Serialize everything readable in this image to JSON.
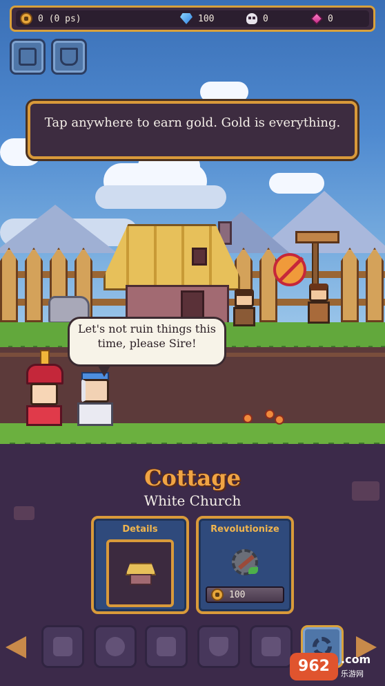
{
  "hud": {
    "gold": "0 (0 ps)",
    "gems": "100",
    "skulls": "0",
    "rubies": "0"
  },
  "icons": {
    "gold": "coin-icon",
    "gems": "diamond-icon",
    "skulls": "skull-icon",
    "rubies": "pink-gem-icon",
    "top_left_1": "map-icon",
    "top_left_2": "trophy-book-icon"
  },
  "tutorial": {
    "text": "Tap anywhere to earn gold. Gold is everything."
  },
  "speech": {
    "text": "Let's not ruin things this time, please Sire!"
  },
  "building": {
    "name": "Cottage",
    "subtitle": "White Church"
  },
  "cards": {
    "details_label": "Details",
    "revolutionize_label": "Revolutionize",
    "revolutionize_cost": "100"
  },
  "nav": {
    "items": [
      "trophy-icon",
      "compass-icon",
      "paw-icon",
      "shield-icon",
      "cat-icon",
      "settings-gear-icon"
    ],
    "active": "settings-gear-icon"
  },
  "watermark": {
    "logo": "962",
    "title": ".com",
    "subtitle": "乐游网"
  },
  "colors": {
    "gold_accent": "#d99a3a",
    "title_orange": "#f0a444",
    "panel_blue": "#2f4a7c",
    "panel_dark": "#3d2c40"
  }
}
